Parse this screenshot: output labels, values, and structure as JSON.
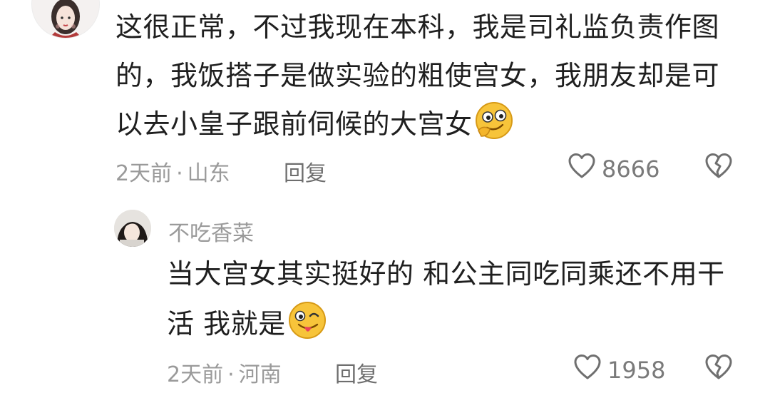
{
  "comment": {
    "lines": [
      "这很正常，不过我现在本科，我是司礼监负责作图",
      "的，我饭搭子是做实验的粗使宫女，我朋友却是可",
      "以去小皇子跟前伺候的大宫女"
    ],
    "emoji": "smug-face-emoji",
    "time": "2天前",
    "location": "山东",
    "reply_label": "回复",
    "likes": "8666"
  },
  "reply": {
    "username": "不吃香菜",
    "lines": [
      "当大宫女其实挺好的 和公主同吃同乘还不用干",
      "活 我就是"
    ],
    "emoji": "winking-tongue-emoji",
    "time": "2天前",
    "location": "河南",
    "reply_label": "回复",
    "likes": "1958"
  },
  "meta_separator": "·",
  "colors": {
    "text": "#1f1f1f",
    "meta": "#9a9a9a",
    "emoji": "#f7c43a"
  }
}
